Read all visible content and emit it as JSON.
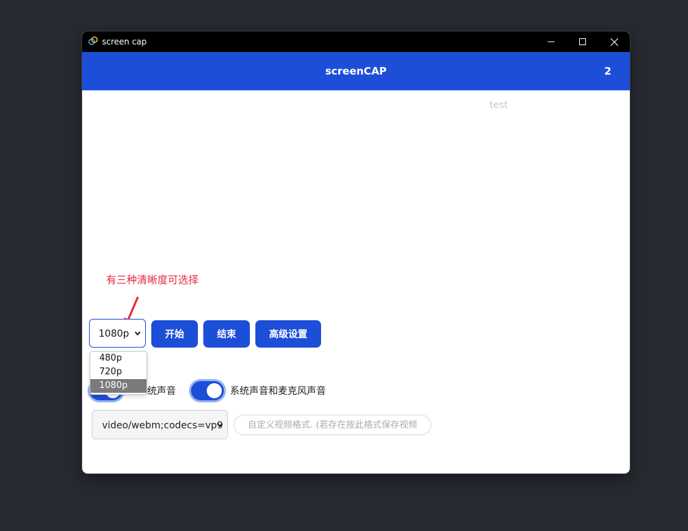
{
  "window": {
    "title": "screen cap"
  },
  "header": {
    "title": "screenCAP",
    "count": "2"
  },
  "test_label": "test",
  "annotation": "有三种清晰度可选择",
  "resolution": {
    "selected": "1080p",
    "options": [
      "480p",
      "720p",
      "1080p"
    ]
  },
  "buttons": {
    "start": "开始",
    "stop": "结束",
    "advanced": "高级设置"
  },
  "toggles": [
    {
      "label": "只系统声音",
      "on": true
    },
    {
      "label": "系统声音和麦克风声音",
      "on": true
    }
  ],
  "format": {
    "selected": "video/webm;codecs=vp9",
    "input_placeholder": "自定义视频格式. (若存在按此格式保存视频)"
  },
  "colors": {
    "accent": "#1d4ed8",
    "annotation": "#e8283b",
    "desktop": "#272a31"
  }
}
